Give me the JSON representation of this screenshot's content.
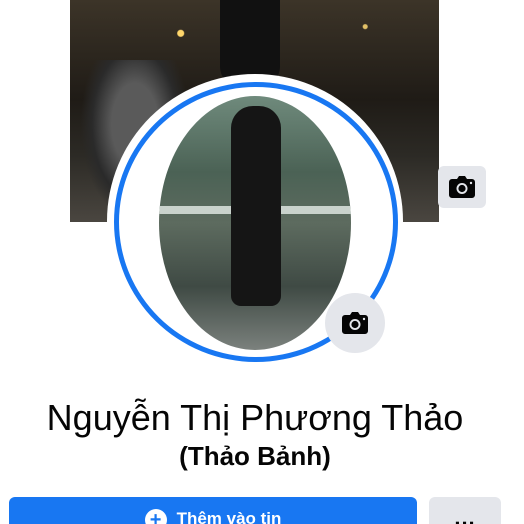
{
  "profile": {
    "name": "Nguyễn Thị Phương Thảo",
    "nickname": "(Thảo Bảnh)"
  },
  "actions": {
    "add_story_label": "Thêm vào tin",
    "add_story_icon": "plus-circle-icon",
    "more_label": "...",
    "cover_camera_icon": "camera-icon",
    "avatar_camera_icon": "camera-icon"
  },
  "colors": {
    "accent": "#1877f2",
    "button_secondary": "#e4e6eb",
    "text": "#050505"
  }
}
